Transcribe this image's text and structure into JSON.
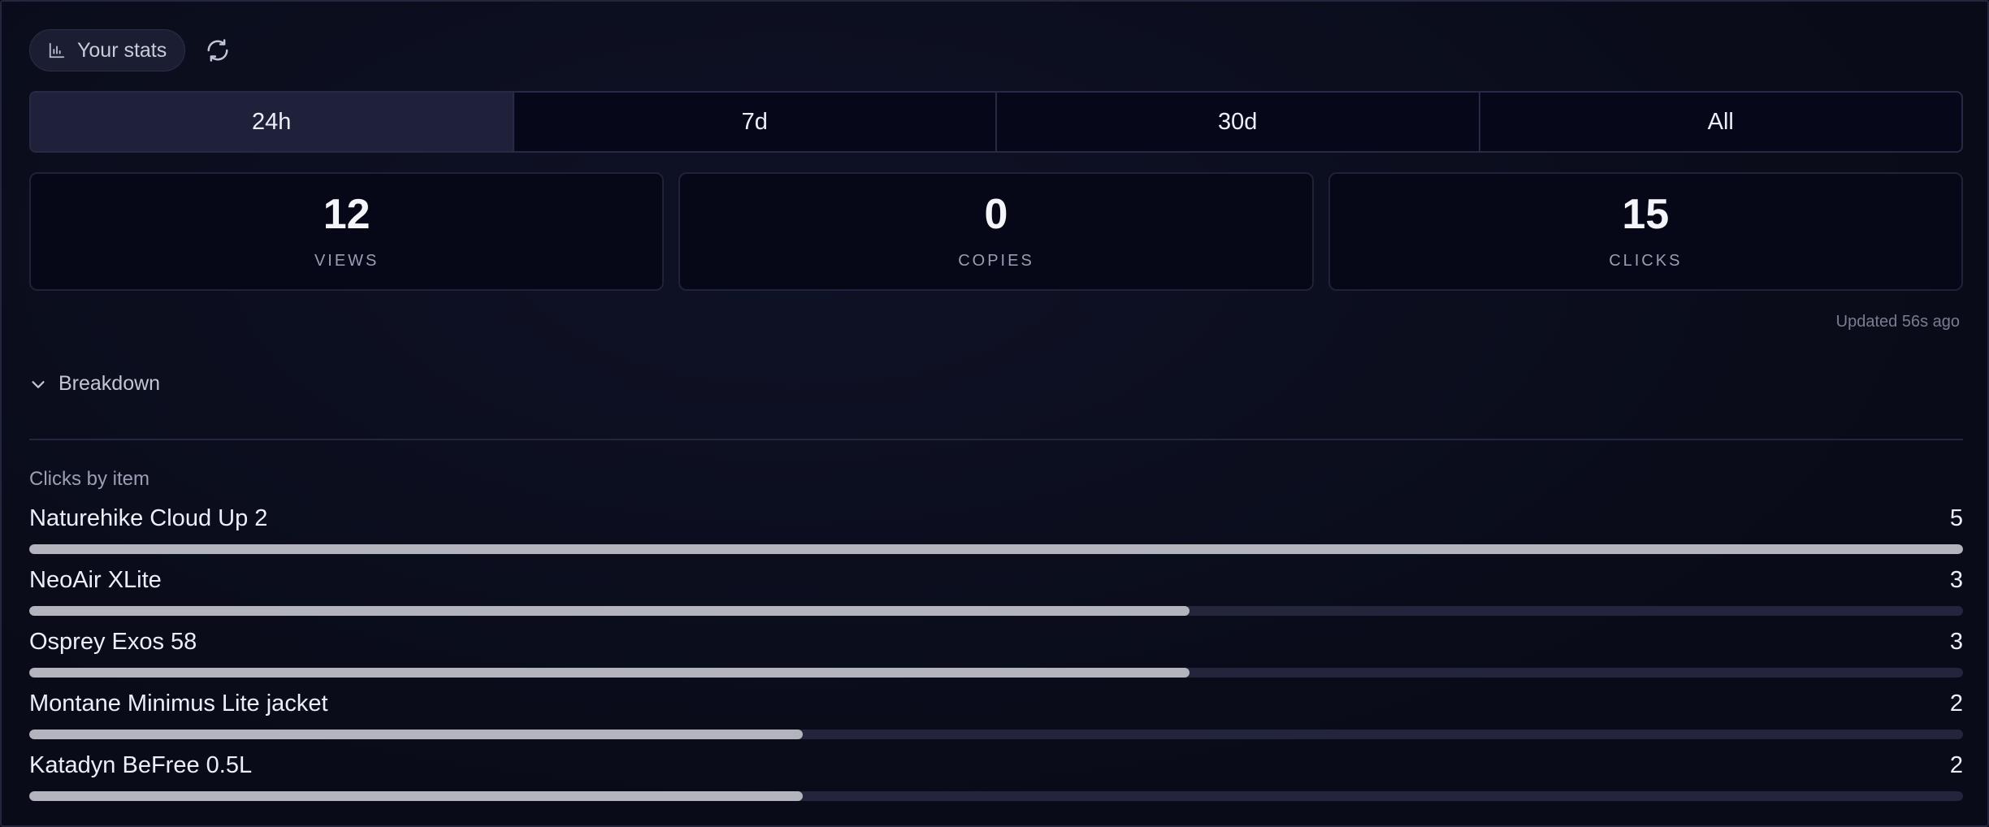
{
  "header": {
    "stats_label": "Your stats",
    "stats_icon": "bar-chart-icon",
    "refresh_icon": "refresh-icon"
  },
  "tabs": [
    {
      "label": "24h",
      "active": true
    },
    {
      "label": "7d",
      "active": false
    },
    {
      "label": "30d",
      "active": false
    },
    {
      "label": "All",
      "active": false
    }
  ],
  "metrics": [
    {
      "value": "12",
      "label": "VIEWS"
    },
    {
      "value": "0",
      "label": "COPIES"
    },
    {
      "value": "15",
      "label": "CLICKS"
    }
  ],
  "updated": "Updated 56s ago",
  "breakdown": {
    "label": "Breakdown",
    "icon": "chevron-down-icon",
    "expanded": true
  },
  "clicks": {
    "title": "Clicks by item",
    "max": 5,
    "items": [
      {
        "name": "Naturehike Cloud Up 2",
        "count": 5
      },
      {
        "name": "NeoAir XLite",
        "count": 3
      },
      {
        "name": "Osprey Exos 58",
        "count": 3
      },
      {
        "name": "Montane Minimus Lite jacket",
        "count": 2
      },
      {
        "name": "Katadyn BeFree 0.5L",
        "count": 2
      }
    ]
  },
  "colors": {
    "background": "#0a0c1a",
    "active_tab": "#1e2139",
    "bar_fill": "#b3b4bd",
    "bar_track": "#22253b"
  }
}
